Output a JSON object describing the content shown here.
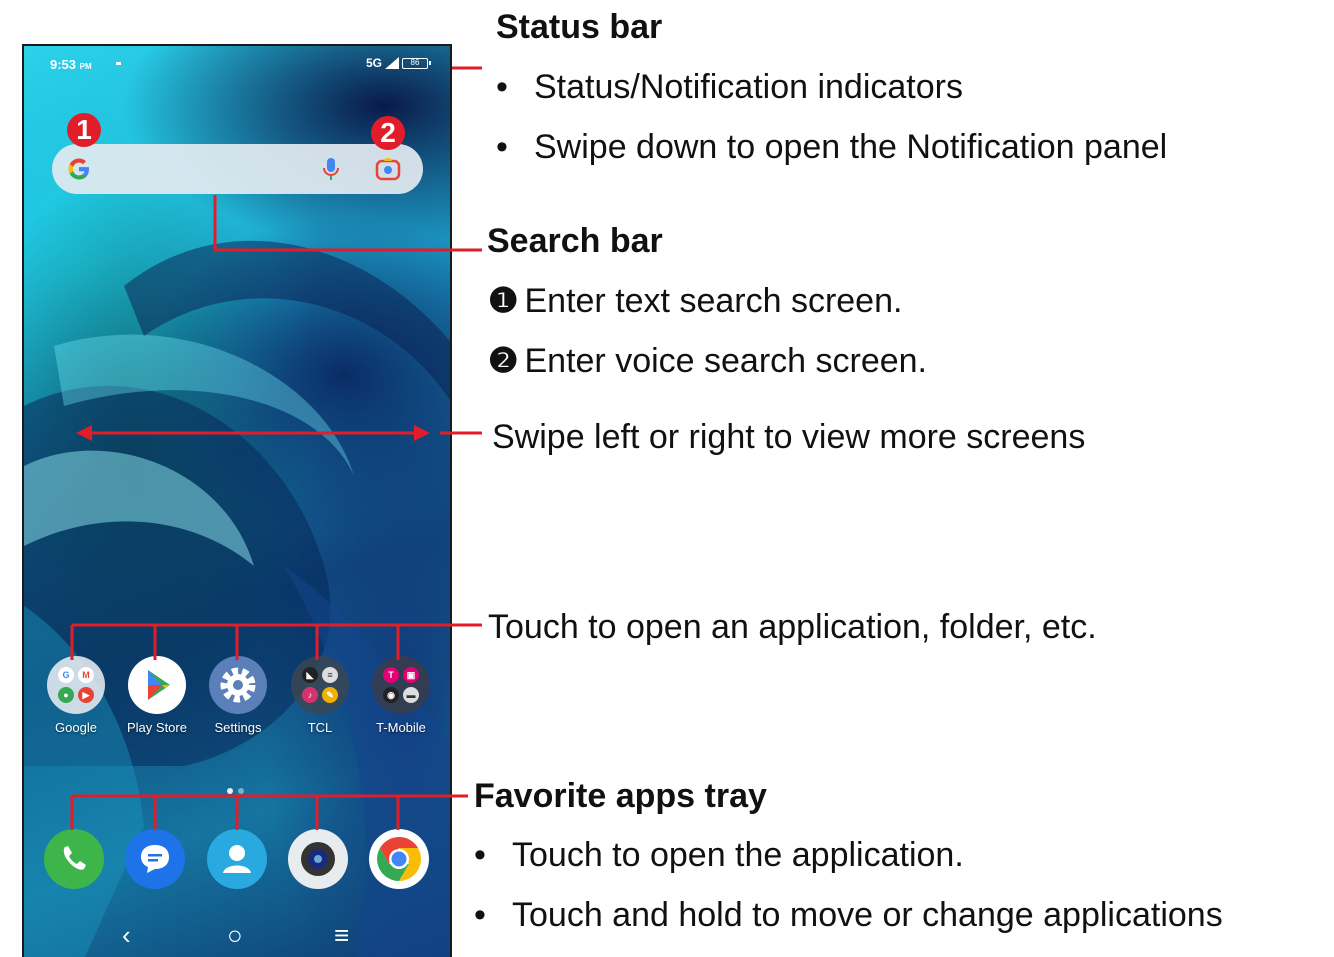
{
  "status_bar": {
    "time": "9:53",
    "ampm": "PM",
    "network": "5G",
    "battery": "86"
  },
  "search": {
    "badge_1": "1",
    "badge_2": "2"
  },
  "apps": [
    {
      "label": "Google"
    },
    {
      "label": "Play Store"
    },
    {
      "label": "Settings"
    },
    {
      "label": "TCL"
    },
    {
      "label": "T-Mobile"
    }
  ],
  "dock_apps": [
    "phone-icon",
    "messages-icon",
    "contacts-icon",
    "camera-icon",
    "chrome-icon"
  ],
  "nav": {
    "back": "‹",
    "home": "○",
    "recents": "≡"
  },
  "callouts": {
    "status_bar_title": "Status bar",
    "status_bullet_1": "Status/Notification indicators",
    "status_bullet_2": "Swipe down to open the Notification panel",
    "search_bar_title": "Search bar",
    "search_num_1": "❶",
    "search_item_1": "Enter text search screen.",
    "search_num_2": "❷",
    "search_item_2": "Enter voice search screen.",
    "swipe": "Swipe left or right to view more screens",
    "touch_open": "Touch to open an application, folder, etc.",
    "favorites_title": "Favorite apps tray",
    "favorites_bullet_1": "Touch to open the application.",
    "favorites_bullet_2": "Touch and hold to move or change applications"
  },
  "colors": {
    "callout_red": "#e11d2a",
    "wallpaper_dark": "#0e3c72",
    "wallpaper_light": "#2bd3ea"
  }
}
